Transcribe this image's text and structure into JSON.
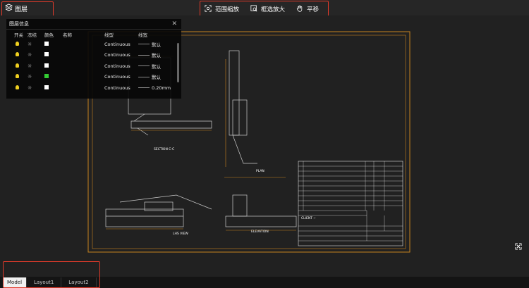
{
  "toolbar": {
    "layers_label": "图层",
    "tools": [
      {
        "label": "范围缩放",
        "icon": "zoom-extents-icon"
      },
      {
        "label": "框选放大",
        "icon": "window-zoom-icon"
      },
      {
        "label": "平移",
        "icon": "hand-pan-icon"
      }
    ]
  },
  "layer_panel": {
    "title": "图层信息",
    "columns": [
      "开关",
      "冻结",
      "颜色",
      "名称",
      "线型",
      "线宽"
    ],
    "rows": [
      {
        "on": true,
        "frozen": false,
        "color": "#ffffff",
        "name": "",
        "linetype": "Continuous",
        "lineweight": "默认"
      },
      {
        "on": true,
        "frozen": false,
        "color": "#ffffff",
        "name": "",
        "linetype": "Continuous",
        "lineweight": "默认"
      },
      {
        "on": true,
        "frozen": false,
        "color": "#ffffff",
        "name": "",
        "linetype": "Continuous",
        "lineweight": "默认"
      },
      {
        "on": true,
        "frozen": false,
        "color": "#33cc33",
        "name": "",
        "linetype": "Continuous",
        "lineweight": "默认"
      },
      {
        "on": true,
        "frozen": false,
        "color": "#ffffff",
        "name": "",
        "linetype": "Continuous",
        "lineweight": "0.20mm"
      }
    ]
  },
  "drawing": {
    "labels": {
      "section": "SECTION C-C",
      "plan": "PLAN",
      "lhs_view": "LHS VIEW",
      "elevation": "ELEVATION",
      "client": "CLIENT :-"
    }
  },
  "tabs": [
    {
      "label": "Model",
      "active": true
    },
    {
      "label": "Layout1",
      "active": false
    },
    {
      "label": "Layout2",
      "active": false
    }
  ],
  "colors": {
    "accent": "#e03a2a",
    "frame": "#c8821e",
    "bulb": "#f0d020"
  }
}
